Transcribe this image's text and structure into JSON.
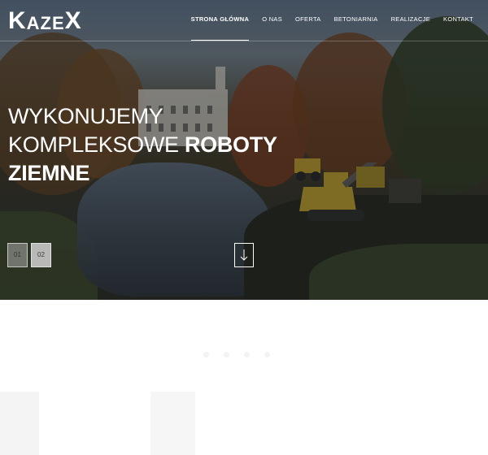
{
  "brand": {
    "logo_text_1": "K",
    "logo_text_2": "AZE",
    "logo_text_3": "X"
  },
  "nav": {
    "items": [
      {
        "label": "STRONA GŁÓWNA",
        "active": true
      },
      {
        "label": "O NAS",
        "active": false
      },
      {
        "label": "OFERTA",
        "active": false
      },
      {
        "label": "BETONIARNIA",
        "active": false
      },
      {
        "label": "REALIZACJE",
        "active": false
      },
      {
        "label": "KONTAKT",
        "active": false
      }
    ]
  },
  "hero": {
    "line1": "WYKONUJEMY",
    "line2_regular": "KOMPLEKSOWE ",
    "line2_bold": "ROBOTY",
    "line3_bold": "ZIEMNE",
    "slides": [
      "01",
      "02"
    ],
    "scroll_icon": "arrow-down-icon"
  },
  "colors": {
    "text": "#ffffff",
    "overlay": "#14161a"
  }
}
